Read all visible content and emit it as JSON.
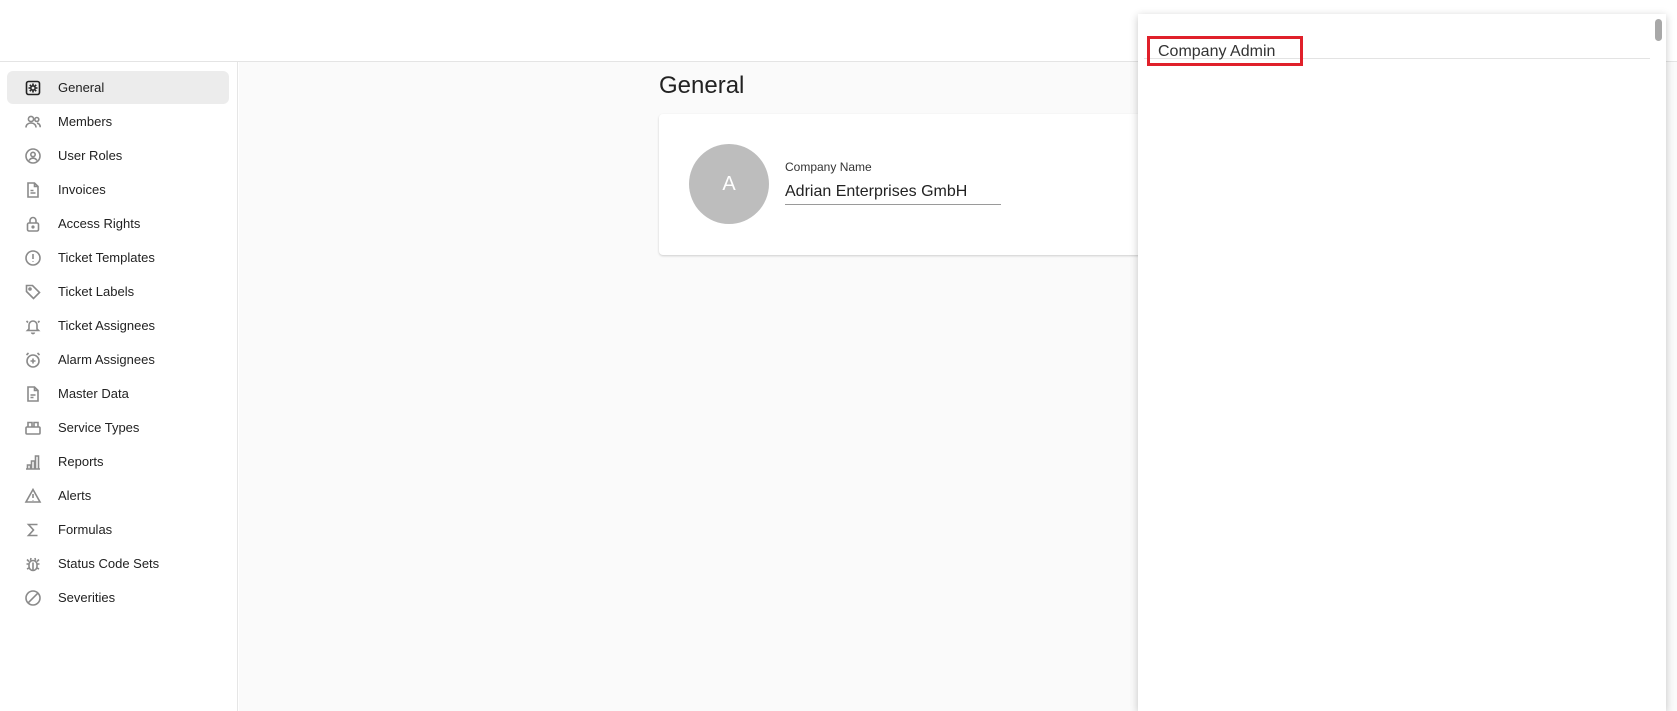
{
  "sidebar": {
    "items": [
      {
        "label": "General",
        "icon": "gear-icon",
        "active": true
      },
      {
        "label": "Members",
        "icon": "users-icon"
      },
      {
        "label": "User Roles",
        "icon": "user-circle-icon"
      },
      {
        "label": "Invoices",
        "icon": "document-icon"
      },
      {
        "label": "Access Rights",
        "icon": "lock-icon"
      },
      {
        "label": "Ticket Templates",
        "icon": "exclamation-circle-icon"
      },
      {
        "label": "Ticket Labels",
        "icon": "tag-icon"
      },
      {
        "label": "Ticket Assignees",
        "icon": "bell-icon"
      },
      {
        "label": "Alarm Assignees",
        "icon": "alarm-icon"
      },
      {
        "label": "Master Data",
        "icon": "file-icon"
      },
      {
        "label": "Service Types",
        "icon": "service-icon"
      },
      {
        "label": "Reports",
        "icon": "bar-chart-icon"
      },
      {
        "label": "Alerts",
        "icon": "warning-icon"
      },
      {
        "label": "Formulas",
        "icon": "sigma-icon"
      },
      {
        "label": "Status Code Sets",
        "icon": "bug-icon"
      },
      {
        "label": "Severities",
        "icon": "ban-icon"
      }
    ]
  },
  "main": {
    "title": "General",
    "card": {
      "avatar_letter": "A",
      "company_name_label": "Company Name",
      "company_name_value": "Adrian Enterprises GmbH"
    }
  },
  "dropdown": {
    "options": [
      {
        "label": "Company Admin",
        "highlighted": true
      }
    ]
  },
  "colors": {
    "highlight_border": "#e0202a",
    "avatar_bg": "#bdbdbd",
    "active_nav_bg": "#ececec"
  }
}
